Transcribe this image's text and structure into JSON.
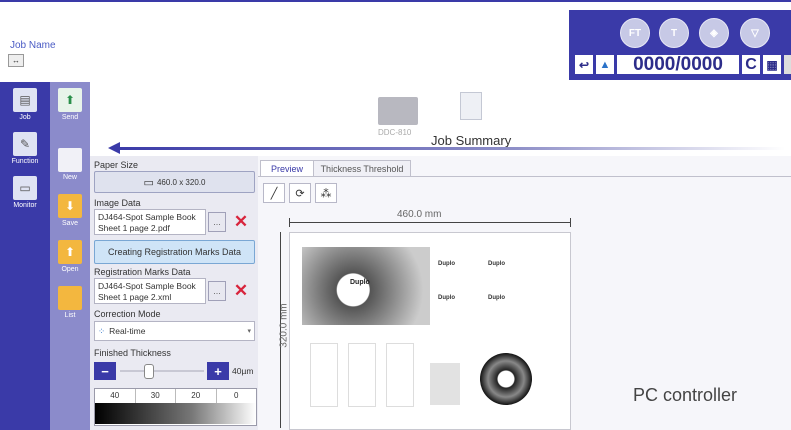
{
  "header": {
    "job_name_label": "Job Name",
    "job_name_icon": "swap-arrows-icon",
    "screen_label": "DDC-810",
    "title": "Job Summary"
  },
  "status_panel": {
    "round_buttons": [
      "FT",
      "T",
      "",
      ""
    ],
    "counter": "0000/0000",
    "clear_label": "C"
  },
  "sidebar": {
    "items": [
      {
        "label": "Job",
        "icon": "document-icon"
      },
      {
        "label": "Function",
        "icon": "wrench-icon"
      },
      {
        "label": "Monitor",
        "icon": "monitor-icon"
      }
    ]
  },
  "file_bar": {
    "items": [
      {
        "label": "Send",
        "icon": "upload-icon"
      },
      {
        "label": "New",
        "icon": "new-document-icon"
      },
      {
        "label": "Save",
        "icon": "save-folder-icon"
      },
      {
        "label": "Open",
        "icon": "open-folder-icon"
      },
      {
        "label": "List",
        "icon": "list-folder-icon"
      }
    ]
  },
  "settings": {
    "paper_size_label": "Paper Size",
    "paper_size_value": "460.0 x 320.0",
    "image_data_label": "Image Data",
    "image_data_line1": "DJ464-Spot Sample Book",
    "image_data_line2": "Sheet 1 page 2.pdf",
    "browse_label": "...",
    "create_marks_label": "Creating Registration Marks Data",
    "reg_marks_label": "Registration Marks Data",
    "reg_marks_line1": "DJ464-Spot Sample Book",
    "reg_marks_line2": "Sheet 1 page 2.xml",
    "correction_label": "Correction Mode",
    "correction_value": "Real-time",
    "thickness_label": "Finished Thickness",
    "thickness_value": "40µm",
    "thickness_scale": [
      "40",
      "30",
      "20",
      "0"
    ]
  },
  "preview": {
    "tabs": [
      "Preview",
      "Thickness Threshold"
    ],
    "width_label": "460.0 mm",
    "height_label": "320.0 mm",
    "brand_label": "Duplo"
  },
  "caption": "PC controller",
  "colors": {
    "primary": "#3a3aa8",
    "secondary": "#8b8bcb",
    "alert": "#d8243c"
  }
}
